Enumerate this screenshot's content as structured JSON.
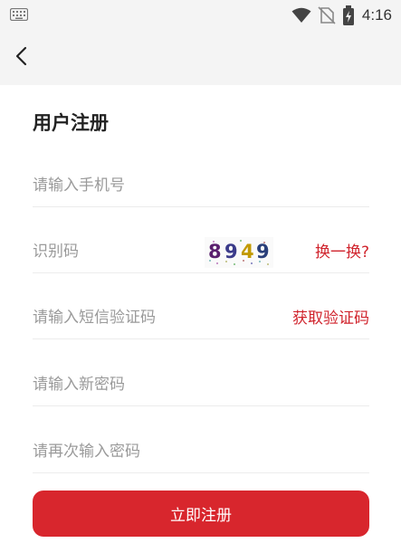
{
  "status_bar": {
    "time": "4:16",
    "icons": [
      "keyboard-icon",
      "wifi-icon",
      "no-sim-icon",
      "battery-icon"
    ]
  },
  "nav": {
    "back_icon": "chevron-left-icon"
  },
  "form": {
    "title": "用户注册",
    "phone_placeholder": "请输入手机号",
    "captcha_placeholder": "识别码",
    "captcha_digits": [
      {
        "char": "8",
        "color": "#5a1f6e"
      },
      {
        "char": "9",
        "color": "#3b3b8a"
      },
      {
        "char": "4",
        "color": "#c29a00"
      },
      {
        "char": "9",
        "color": "#2a3f7a"
      }
    ],
    "refresh_label": "换一换?",
    "sms_placeholder": "请输入短信验证码",
    "get_code_label": "获取验证码",
    "new_password_placeholder": "请输入新密码",
    "confirm_password_placeholder": "请再次输入密码",
    "submit_label": "立即注册"
  },
  "colors": {
    "accent": "#d8262d",
    "link": "#d0242d",
    "background": "#f4f4f4",
    "card": "#ffffff"
  }
}
